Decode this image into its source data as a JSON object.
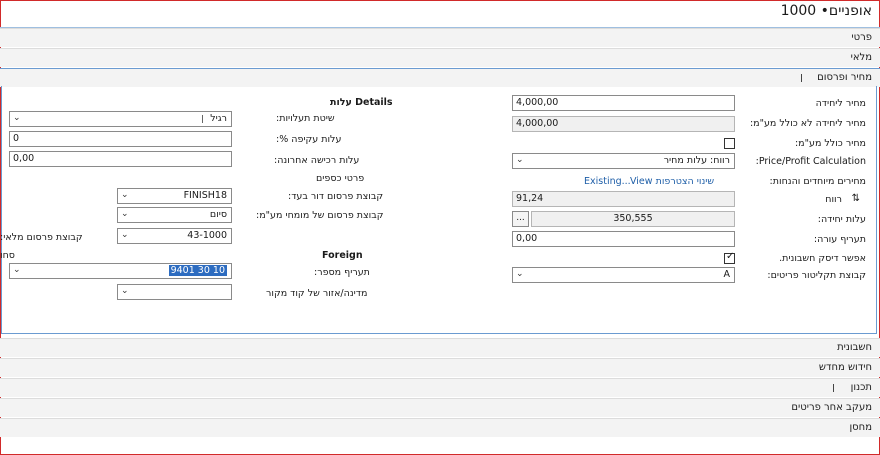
{
  "window": {
    "title": "1000 •אופניים"
  },
  "sections_top": [
    {
      "label": "פרטי"
    },
    {
      "label": "מלאי"
    },
    {
      "label": "מחיר ופרסום"
    }
  ],
  "sections_bottom": [
    {
      "label": "חשבונית"
    },
    {
      "label": "חידוש מחדש"
    },
    {
      "label": "תכנון"
    },
    {
      "label": "מעקב אחר פריטים"
    },
    {
      "label": "מחסן"
    }
  ],
  "price": {
    "unit_price": {
      "label": "מחיר ליחידה",
      "value": "4,000,00"
    },
    "unit_price_excl": {
      "label": "מחיר ליחידה לא כולל מע\"מ:",
      "value": "4,000,00"
    },
    "price_incl_vat": {
      "label": "מחיר כולל מע\"מ:"
    },
    "price_profit_calc": {
      "label": "Price/Profit Calculation:",
      "value": "רווח: עלות מחיר"
    },
    "special_prices": {
      "label": "מחירים מיוחדים והנחות:",
      "link": "View שינוי הצטרפות",
      "link_suffix": "Existing..."
    },
    "profit": {
      "label": "רווח",
      "value": "91,24"
    },
    "unit_cost": {
      "label": "עלות יחידה:",
      "value": "350,555",
      "button": "..."
    },
    "indirect_cost": {
      "label": "תעריף עורה:",
      "value": "0,00"
    },
    "allow_invoice_disc": {
      "label": "אפשר דיסק חשבונית."
    },
    "item_disc_group": {
      "label": "קבוצת תקליטור פריטים:",
      "value": "A"
    }
  },
  "cost": {
    "group_title": "עלות Details",
    "costing_method": {
      "label": "שיטת תעלויות:",
      "value": "רגיל"
    },
    "indirect_cost_pct": {
      "label": "עלות עקיפה %:",
      "value": "0"
    },
    "last_direct_cost": {
      "label": "עלות רכישה אחרונה:",
      "value": "0,00"
    },
    "financial_details": {
      "label": "פרטי כספים"
    },
    "gen_prod_posting": {
      "label": "קבוצת פרסום דור בעד:",
      "value": "FINISH18"
    },
    "vat_prod_posting": {
      "label": "קבוצת פרסום של מומחי מע\"מ:",
      "value": "סיום"
    },
    "inventory_posting": {
      "label": "קבוצת פרסום מלאי:",
      "value": "43-1000"
    },
    "foreign_title": "Foreign",
    "tariff_no": {
      "label": "תעריף מספר:",
      "value": "9401 30 10"
    },
    "country_origin": {
      "label": "מדינה/אזור של קוד מקור",
      "value": ""
    },
    "edge_text": "סחו"
  },
  "icons": {
    "chevron": "chevron-down-icon",
    "sort": "sort-icon"
  }
}
